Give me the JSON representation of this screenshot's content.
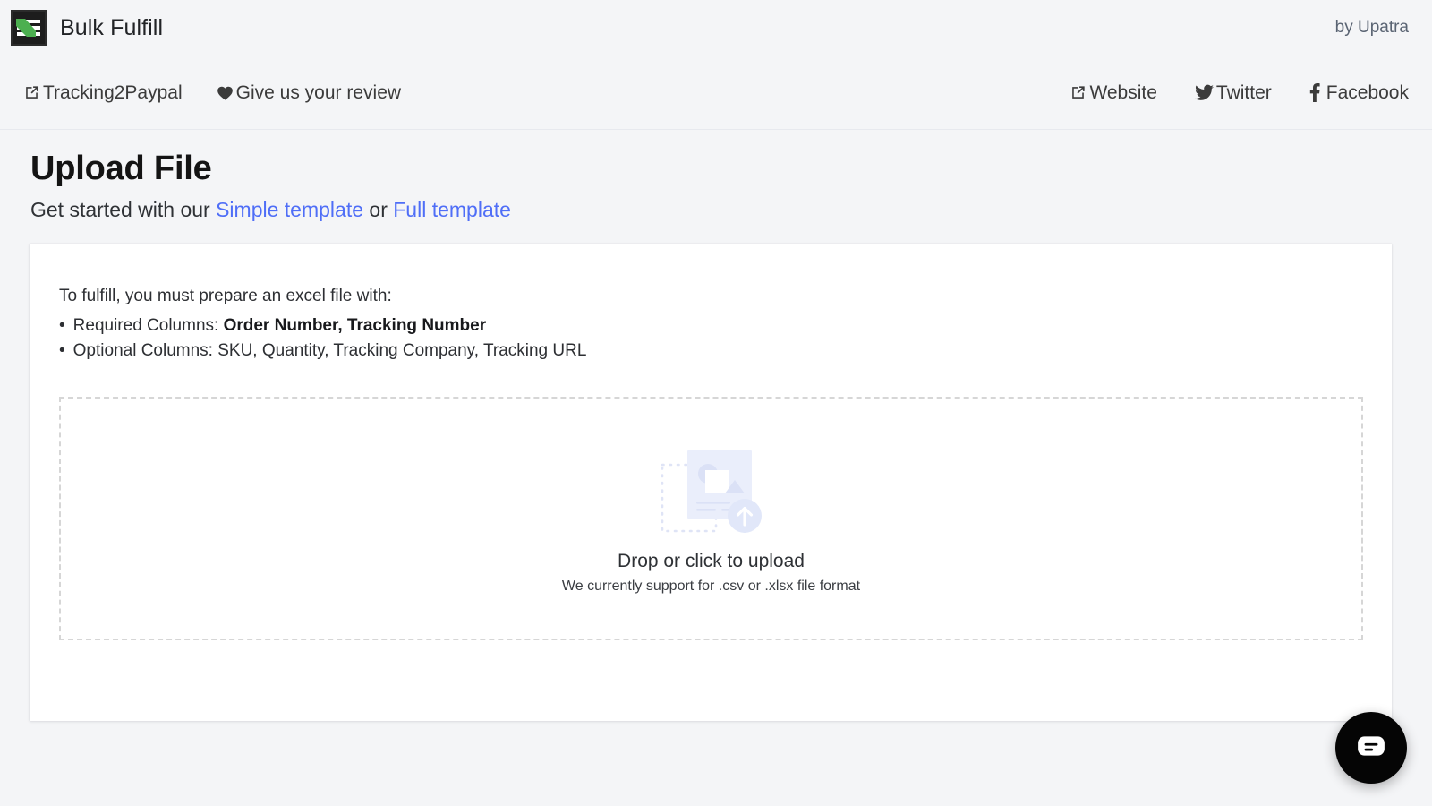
{
  "header": {
    "brand_title": "Bulk Fulfill",
    "logo_icon": "bulk-fulfill-logo",
    "attribution": "by Upatra"
  },
  "nav": {
    "left_links": [
      {
        "label": "Tracking2Paypal",
        "icon": "external-link-icon"
      },
      {
        "label": "Give us your review",
        "icon": "heart-icon"
      }
    ],
    "right_links": [
      {
        "label": "Website",
        "icon": "external-link-icon"
      },
      {
        "label": "Twitter",
        "icon": "twitter-icon"
      },
      {
        "label": "Facebook",
        "icon": "facebook-icon"
      }
    ]
  },
  "page": {
    "title": "Upload File",
    "subtitle_prefix": "Get started with our ",
    "simple_template_link": "Simple template",
    "subtitle_middle": " or ",
    "full_template_link": "Full template"
  },
  "card": {
    "intro": "To fulfill, you must prepare an excel file with:",
    "bullet_marker": "•",
    "required_label": "Required Columns: ",
    "required_value": "Order Number, Tracking Number",
    "optional_label": "Optional Columns: ",
    "optional_value": "SKU, Quantity, Tracking Company, Tracking URL"
  },
  "dropzone": {
    "illustration_icon": "file-upload-illustration",
    "title": "Drop or click to upload",
    "subtitle": "We currently support for .csv or .xlsx file format"
  },
  "chat": {
    "icon": "chat-bubble-icon"
  },
  "colors": {
    "page_background": "#f4f5f7",
    "card_background": "#ffffff",
    "link_blue": "#4f6ef7",
    "attribution_gray": "#5a6473",
    "dashed_border": "#d6d6d6",
    "illustration_lavender": "#e6eaf8",
    "chat_fab": "#050505",
    "logo_green": "#4caf50"
  }
}
